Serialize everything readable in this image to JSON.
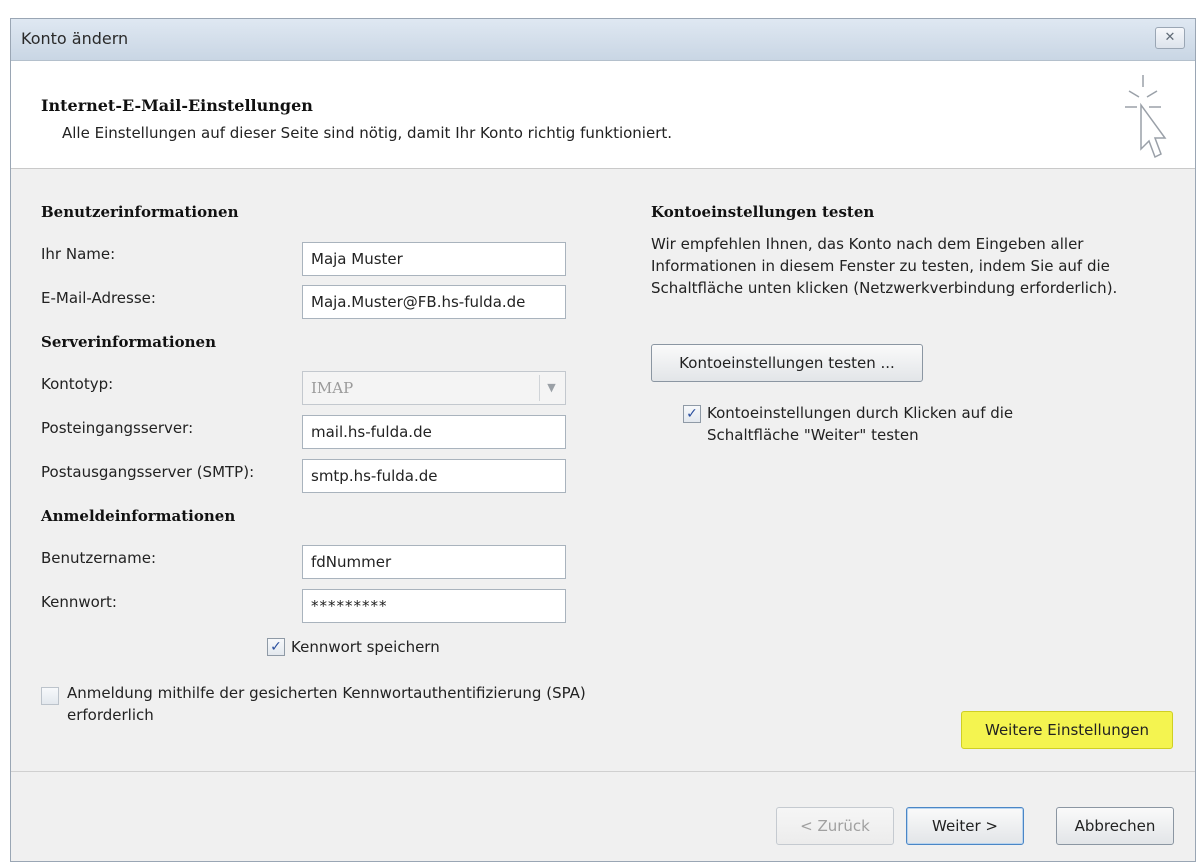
{
  "window": {
    "title": "Konto ändern",
    "close_label": "✕"
  },
  "header": {
    "title": "Internet-E-Mail-Einstellungen",
    "subtitle": "Alle Einstellungen auf dieser Seite sind nötig, damit Ihr Konto richtig funktioniert."
  },
  "user_info": {
    "section_title": "Benutzerinformationen",
    "name_label": "Ihr Name:",
    "name_value": "Maja Muster",
    "email_label": "E-Mail-Adresse:",
    "email_value": "Maja.Muster@FB.hs-fulda.de"
  },
  "server_info": {
    "section_title": "Serverinformationen",
    "account_type_label": "Kontotyp:",
    "account_type_value": "IMAP",
    "incoming_label": "Posteingangsserver:",
    "incoming_value": "mail.hs-fulda.de",
    "outgoing_label": "Postausgangsserver (SMTP):",
    "outgoing_value": "smtp.hs-fulda.de"
  },
  "login_info": {
    "section_title": "Anmeldeinformationen",
    "username_label": "Benutzername:",
    "username_value": "fdNummer",
    "password_label": "Kennwort:",
    "password_value": "*********",
    "save_password_label": "Kennwort speichern",
    "save_password_checked": true,
    "spa_label": "Anmeldung mithilfe der gesicherten Kennwortauthentifizierung (SPA) erforderlich",
    "spa_checked": false
  },
  "test_settings": {
    "section_title": "Kontoeinstellungen testen",
    "description": "Wir empfehlen Ihnen, das Konto nach dem Eingeben aller Informationen in diesem Fenster zu testen, indem Sie auf die Schaltfläche unten klicken (Netzwerkverbindung erforderlich).",
    "test_button": "Kontoeinstellungen testen ...",
    "test_on_next_label": "Kontoeinstellungen durch Klicken auf die Schaltfläche \"Weiter\" testen",
    "test_on_next_checked": true,
    "more_settings_button": "Weitere Einstellungen"
  },
  "footer": {
    "back_button": "< Zurück",
    "next_button": "Weiter >",
    "cancel_button": "Abbrechen"
  },
  "colors": {
    "highlight": "#f4f450",
    "checkmark": "#2a4f9e"
  }
}
